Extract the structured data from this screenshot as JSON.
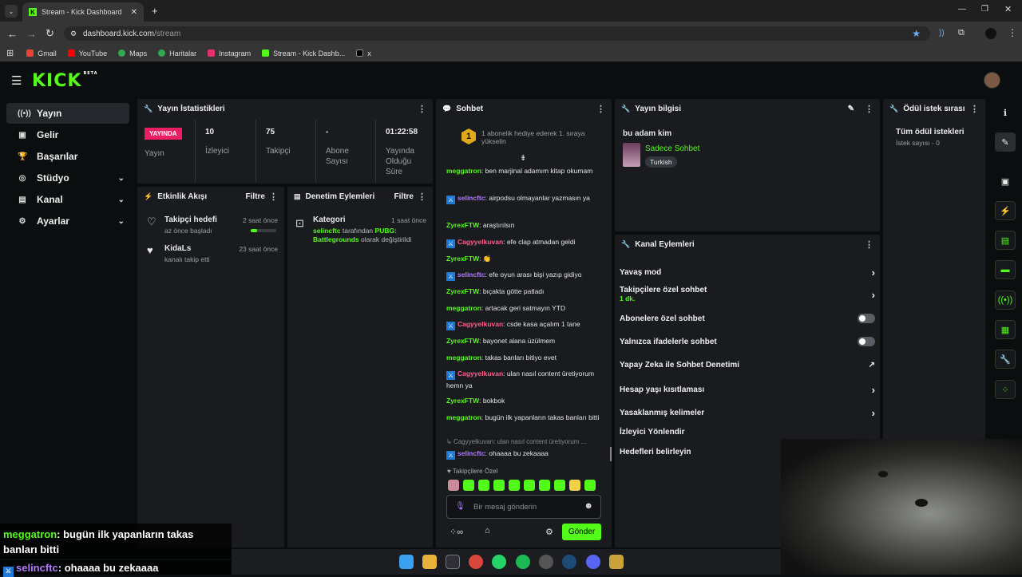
{
  "browser": {
    "tab_title": "Stream - Kick Dashboard",
    "url_host": "dashboard.kick.com",
    "url_path": "/stream",
    "bookmarks": [
      {
        "label": "Gmail",
        "color": "#ea4335"
      },
      {
        "label": "YouTube",
        "color": "#ff0000"
      },
      {
        "label": "Maps",
        "color": "#34a853"
      },
      {
        "label": "Haritalar",
        "color": "#34a853"
      },
      {
        "label": "Instagram",
        "color": "#e1306c"
      },
      {
        "label": "Stream - Kick Dashb...",
        "color": "#53fc18"
      },
      {
        "label": "x",
        "color": "#000000"
      }
    ]
  },
  "header": {
    "logo": "KICK",
    "logo_tag": "BETA"
  },
  "sidebar": {
    "items": [
      {
        "label": "Yayın",
        "icon": "broadcast-icon"
      },
      {
        "label": "Gelir",
        "icon": "money-icon"
      },
      {
        "label": "Başarılar",
        "icon": "trophy-icon"
      },
      {
        "label": "Stüdyo",
        "icon": "studio-icon"
      },
      {
        "label": "Kanal",
        "icon": "channel-icon"
      },
      {
        "label": "Ayarlar",
        "icon": "gear-icon"
      }
    ]
  },
  "stats": {
    "title": "Yayın İstatistikleri",
    "live_badge": "YAYINDA",
    "live_label": "Yayın",
    "viewers_value": "10",
    "viewers_label": "İzleyici",
    "followers_value": "75",
    "followers_label": "Takipçi",
    "subs_value": "-",
    "subs_label": "Abone Sayısı",
    "uptime_value": "01:22:58",
    "uptime_label": "Yayında Olduğu Süre"
  },
  "activity": {
    "title": "Etkinlik Akışı",
    "filter": "Filtre",
    "items": [
      {
        "title": "Takipçi hedefi",
        "sub": "az önce başladı",
        "time": "2 saat önce",
        "progress": 0.25
      },
      {
        "title": "KidaLs",
        "sub": "kanalı takip etti",
        "time": "23 saat önce"
      }
    ]
  },
  "moderation": {
    "title": "Denetim Eylemleri",
    "filter": "Filtre",
    "item_title": "Kategori",
    "item_time": "1 saat önce",
    "item_user": "selincftc",
    "item_mid": "tarafından",
    "item_game": "PUBG: Battlegrounds",
    "item_end": "olarak değiştirildi"
  },
  "chat": {
    "title": "Sohbet",
    "gift_rank": "1",
    "gift_text": "1 abonelik hediye ederek 1. sıraya yükselin",
    "messages": [
      {
        "user": "meggatron",
        "color": "#53fc18",
        "badge": false,
        "text": "ben marjinal adamım kitap okumam"
      },
      {
        "user": "selincftc",
        "color": "#b07cff",
        "badge": true,
        "text": "airpodsu olmayanlar yazmasın ya"
      },
      {
        "user": "ZyrexFTW",
        "color": "#53fc18",
        "badge": false,
        "text": "araştırılsın"
      },
      {
        "user": "Cagyyelkuvan",
        "color": "#ff5c8a",
        "badge": true,
        "text": "efe clap atmadan geldi"
      },
      {
        "user": "ZyrexFTW",
        "color": "#53fc18",
        "badge": false,
        "text": "👏"
      },
      {
        "user": "selincftc",
        "color": "#b07cff",
        "badge": true,
        "text": "efe oyun arası bişi yazıp gidiyo"
      },
      {
        "user": "ZyrexFTW",
        "color": "#53fc18",
        "badge": false,
        "text": "bıçakta götte patladı"
      },
      {
        "user": "meggatron",
        "color": "#53fc18",
        "badge": false,
        "text": "artacak geri satmayın YTD"
      },
      {
        "user": "Cagyyelkuvan",
        "color": "#ff5c8a",
        "badge": true,
        "text": "csde kasa açalım 1 tane"
      },
      {
        "user": "ZyrexFTW",
        "color": "#53fc18",
        "badge": false,
        "text": "bayonet alana üzülmem"
      },
      {
        "user": "meggatron",
        "color": "#53fc18",
        "badge": false,
        "text": "takas banları bitiyo evet"
      },
      {
        "user": "Cagyyelkuvan",
        "color": "#ff5c8a",
        "badge": true,
        "text": "ulan nasıl content üretiyorum hemn ya"
      },
      {
        "user": "ZyrexFTW",
        "color": "#53fc18",
        "badge": false,
        "text": "bokbok"
      },
      {
        "user": "meggatron",
        "color": "#53fc18",
        "badge": false,
        "text": "bugün ilk yapanların takas banları bitti"
      }
    ],
    "reply_context": "Cagyyelkuvan: ulan nasıl content üretiyorum ...",
    "last_user": "selincftc",
    "last_text": "ohaaaa bu zekaaaa",
    "followers_only": "Takipçilere Özel",
    "input_placeholder": "Bir mesaj gönderin",
    "send_label": "Gönder"
  },
  "stream_info": {
    "title": "Yayın bilgisi",
    "stream_title": "bu adam kim",
    "category": "Sadece Sohbet",
    "tag": "Turkish"
  },
  "rewards": {
    "title": "Ödül istek sırası",
    "all_label": "Tüm ödül istekleri",
    "count_label": "İstek sayısı - 0"
  },
  "channel_actions": {
    "title": "Kanal Eylemleri",
    "slow_mode": "Yavaş mod",
    "followers_only": "Takipçilere özel sohbet",
    "followers_only_sub": "1 dk.",
    "subs_only": "Abonelere özel sohbet",
    "emotes_only": "Yalnızca ifadelerle sohbet",
    "ai_moderation": "Yapay Zeka ile Sohbet Denetimi",
    "account_age": "Hesap yaşı kısıtlaması",
    "banned_words": "Yasaklanmış kelimeler",
    "redirect": "İzleyici Yönlendir",
    "goals": "Hedefleri belirleyin"
  },
  "overlay": {
    "line1_user": "meggatron",
    "line1_text": ": bugün ilk yapanların takas banları bitti",
    "line2_user": "selincftc",
    "line2_text": ": ohaaaa bu zekaaaa"
  }
}
